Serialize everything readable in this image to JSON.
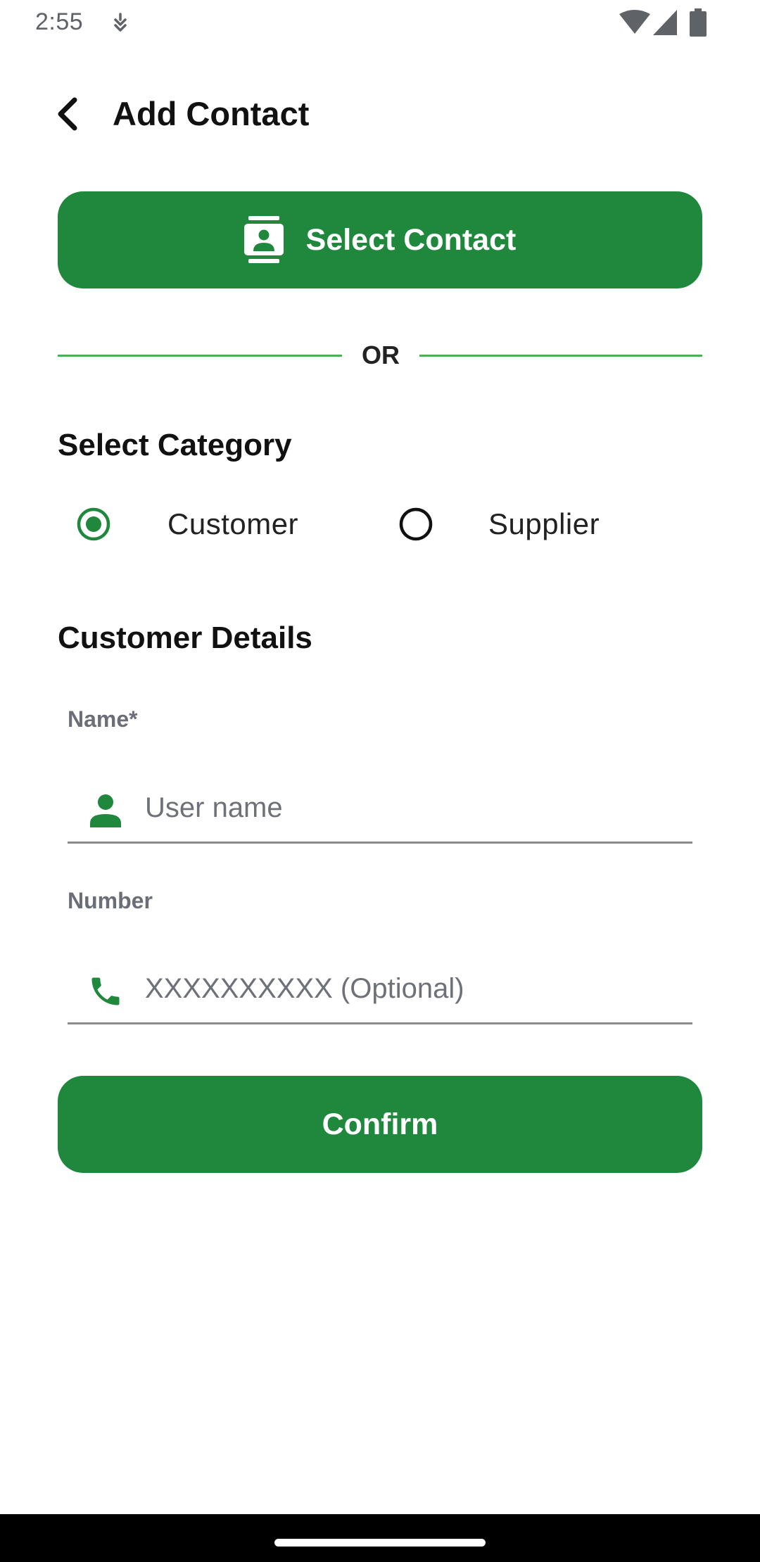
{
  "status_bar": {
    "time": "2:55",
    "icons": [
      "notification-icon",
      "wifi-icon",
      "cellular-signal-icon",
      "battery-icon"
    ]
  },
  "app_bar": {
    "title": "Add Contact",
    "back_icon": "back-arrow-icon"
  },
  "select_contact": {
    "label": "Select Contact",
    "icon": "contacts-icon"
  },
  "divider": {
    "text": "OR"
  },
  "category": {
    "heading": "Select Category",
    "options": [
      {
        "label": "Customer",
        "selected": true
      },
      {
        "label": "Supplier",
        "selected": false
      }
    ]
  },
  "details": {
    "heading": "Customer Details",
    "name_field": {
      "label": "Name*",
      "placeholder": "User name",
      "value": "",
      "icon": "person-icon"
    },
    "number_field": {
      "label": "Number",
      "placeholder": "XXXXXXXXXX (Optional)",
      "value": "",
      "icon": "phone-icon"
    }
  },
  "confirm": {
    "label": "Confirm"
  },
  "colors": {
    "accent": "#1f883d",
    "divider_line": "#4caf50",
    "label_gray": "#6b6e76"
  }
}
